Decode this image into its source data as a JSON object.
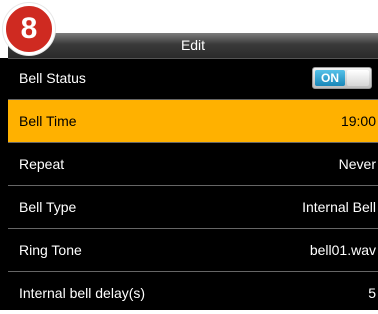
{
  "step_number": "8",
  "header": {
    "title": "Edit"
  },
  "rows": [
    {
      "label": "Bell Status",
      "toggle": "ON"
    },
    {
      "label": "Bell Time",
      "value": "19:00"
    },
    {
      "label": "Repeat",
      "value": "Never"
    },
    {
      "label": "Bell Type",
      "value": "Internal Bell"
    },
    {
      "label": "Ring Tone",
      "value": "bell01.wav"
    },
    {
      "label": "Internal bell delay(s)",
      "value": "5"
    }
  ],
  "colors": {
    "selected_row": "#ffb100",
    "badge": "#cf2a21",
    "toggle_on": "#1987b8"
  }
}
